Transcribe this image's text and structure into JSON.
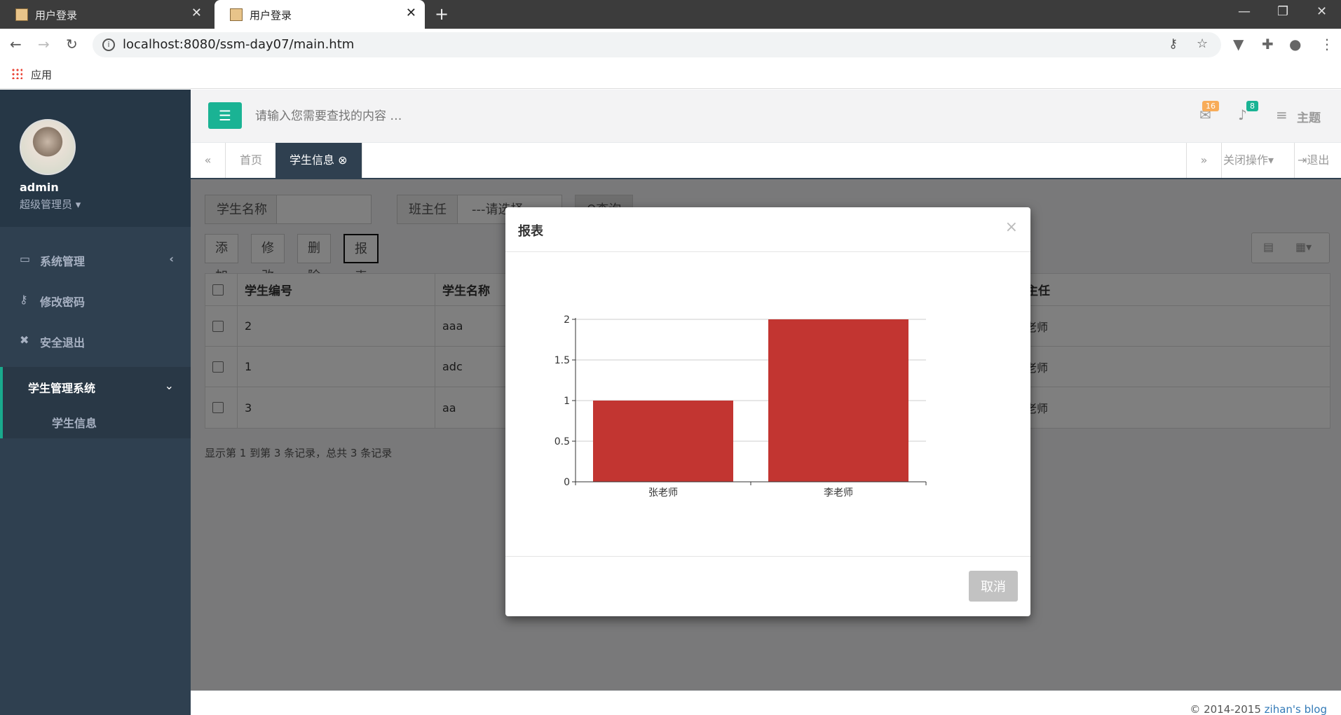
{
  "browser": {
    "tabs": [
      {
        "label": "用户登录",
        "active": false
      },
      {
        "label": "用户登录",
        "active": true
      }
    ],
    "url": "localhost:8080/ssm-day07/main.htm",
    "bookmarks_label": "应用"
  },
  "sidebar": {
    "user_name": "admin",
    "user_role": "超级管理员",
    "items": [
      {
        "label": "系统管理",
        "icon": "monitor-icon"
      },
      {
        "label": "修改密码",
        "icon": "key-icon"
      },
      {
        "label": "安全退出",
        "icon": "user-times-icon"
      }
    ],
    "active_group": {
      "label": "学生管理系统",
      "sub_item": "学生信息"
    }
  },
  "topbar": {
    "search_placeholder": "请输入您需要查找的内容 …",
    "mail_count": "16",
    "bell_count": "8",
    "theme_label": "主题",
    "colors": {
      "mail_badge": "#f8ac59",
      "bell_badge": "#1ab394",
      "accent": "#1ab394"
    }
  },
  "content_tabs": {
    "tabs": [
      {
        "label": "首页",
        "active": false
      },
      {
        "label": "学生信息",
        "active": true
      }
    ],
    "close_ops": "关闭操作",
    "logout": "退出"
  },
  "filters": {
    "name_label": "学生名称",
    "teacher_label": "班主任",
    "teacher_select": "---请选择---",
    "query_button": "查询"
  },
  "toolbar": {
    "add": "添加",
    "edit": "修改",
    "delete": "删除",
    "report": "报表"
  },
  "table": {
    "columns": [
      "学生编号",
      "学生名称",
      "班主任"
    ],
    "rows": [
      {
        "id": "2",
        "name": "aaa",
        "teacher": "张老师"
      },
      {
        "id": "1",
        "name": "adc",
        "teacher": "李老师"
      },
      {
        "id": "3",
        "name": "aa",
        "teacher": "李老师"
      }
    ]
  },
  "pagination_text": "显示第 1 到第 3 条记录，总共 3 条记录",
  "footer": {
    "copyright": "© 2014-2015",
    "link": "zihan's blog"
  },
  "modal": {
    "title": "报表",
    "close_symbol": "×",
    "cancel_label": "取消"
  },
  "chart_data": {
    "type": "bar",
    "categories": [
      "张老师",
      "李老师"
    ],
    "values": [
      1,
      2
    ],
    "ylim": [
      0,
      2
    ],
    "yticks": [
      0,
      0.5,
      1,
      1.5,
      2
    ],
    "ytick_labels": [
      "0",
      "0.5",
      "1",
      "1.5",
      "2"
    ],
    "grid": true,
    "bar_color": "#c23531"
  }
}
